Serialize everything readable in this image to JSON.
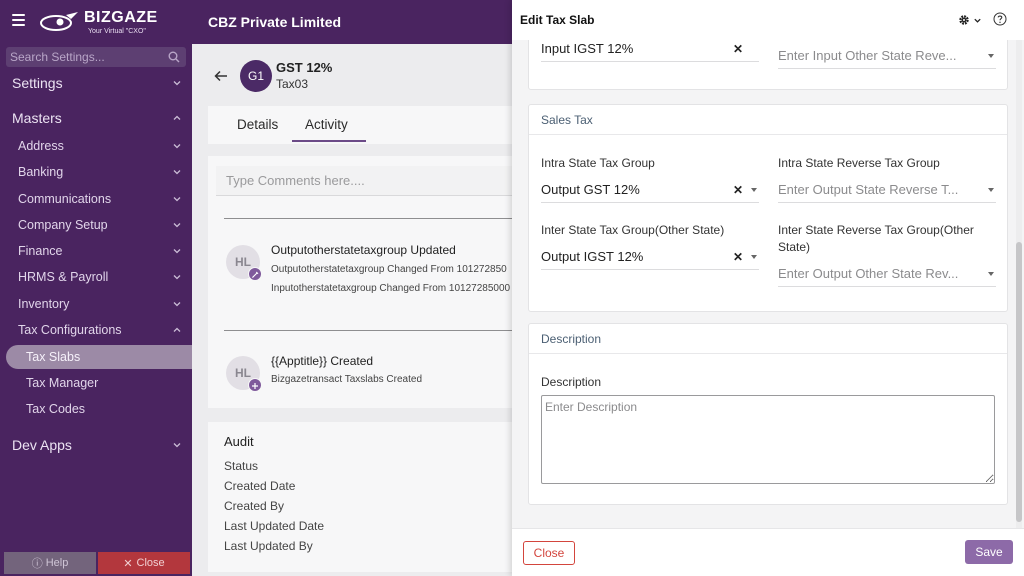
{
  "app": {
    "brand": "BIZGAZE",
    "brand_tm": "TM",
    "tagline": "Your Virtual \"CXO\"",
    "company": "CBZ Private Limited"
  },
  "colors": {
    "brand": "#4a2460",
    "accent": "#8d6aa8",
    "danger": "#d3453d",
    "section_heading": "#4b5f73"
  },
  "sidebar": {
    "search_placeholder": "Search Settings...",
    "settings": "Settings",
    "masters": "Masters",
    "items": [
      "Address",
      "Banking",
      "Communications",
      "Company Setup",
      "Finance",
      "HRMS & Payroll",
      "Inventory",
      "Tax Configurations"
    ],
    "sub_items": [
      "Tax Slabs",
      "Tax Manager",
      "Tax Codes"
    ],
    "active_sub": "Tax Slabs",
    "dev_apps": "Dev Apps",
    "help": "Help",
    "close": "Close"
  },
  "record": {
    "avatar": "G1",
    "title": "GST 12%",
    "code": "Tax03",
    "tabs": [
      "Details",
      "Activity"
    ],
    "active_tab": "Activity",
    "comment_placeholder": "Type Comments here....",
    "activities": [
      {
        "avatar": "HL",
        "title": "Outputotherstatetaxgroup Updated",
        "lines": [
          "Outputotherstatetaxgroup Changed From 101272850",
          "Inputotherstatetaxgroup Changed From 10127285000"
        ]
      },
      {
        "avatar": "HL",
        "title": "{{Apptitle}} Created",
        "lines": [
          "Bizgazetransact Taxslabs Created"
        ]
      }
    ],
    "audit_title": "Audit",
    "audit_rows": [
      "Status",
      "Created Date",
      "Created By",
      "Last Updated Date",
      "Last Updated By"
    ]
  },
  "drawer": {
    "title": "Edit Tax Slab",
    "partial_top": {
      "left_value": "Input IGST 12%",
      "right_placeholder": "Enter Input Other State Reve..."
    },
    "sales_tax": {
      "heading": "Sales Tax",
      "intra_label": "Intra State Tax Group",
      "intra_value": "Output GST 12%",
      "intra_rev_label": "Intra State Reverse Tax Group",
      "intra_rev_placeholder": "Enter Output State Reverse T...",
      "inter_label": "Inter State Tax Group(Other State)",
      "inter_value": "Output IGST 12%",
      "inter_rev_label": "Inter State Reverse Tax Group(Other State)",
      "inter_rev_placeholder": "Enter Output Other State Rev..."
    },
    "description": {
      "heading": "Description",
      "label": "Description",
      "placeholder": "Enter Description"
    },
    "close_label": "Close",
    "save_label": "Save"
  }
}
